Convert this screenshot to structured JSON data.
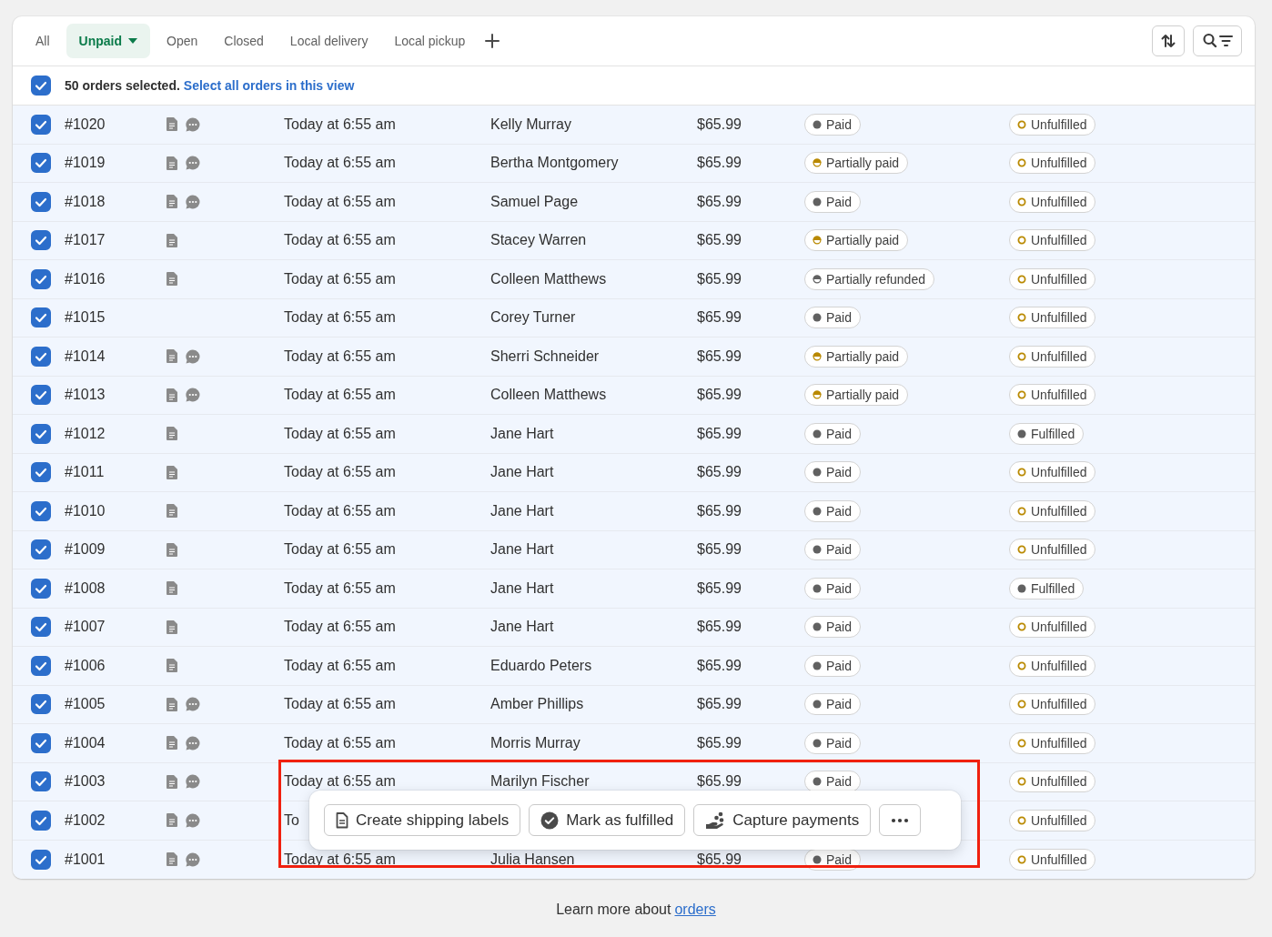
{
  "tabs": [
    {
      "label": "All",
      "selected": false,
      "dropdown": false
    },
    {
      "label": "Unpaid",
      "selected": true,
      "dropdown": true
    },
    {
      "label": "Open",
      "selected": false,
      "dropdown": false
    },
    {
      "label": "Closed",
      "selected": false,
      "dropdown": false
    },
    {
      "label": "Local delivery",
      "selected": false,
      "dropdown": false
    },
    {
      "label": "Local pickup",
      "selected": false,
      "dropdown": false
    }
  ],
  "bulk": {
    "checked": true,
    "text": "50 orders selected.",
    "link": "Select all orders in this view"
  },
  "rows": [
    {
      "checked": true,
      "order": "#1020",
      "note": true,
      "comment": true,
      "date": "Today at 6:55 am",
      "customer": "Kelly Murray",
      "total": "$65.99",
      "payment": {
        "label": "Paid",
        "kind": "paid"
      },
      "fulfillment": {
        "label": "Unfulfilled",
        "kind": "unfulfilled"
      }
    },
    {
      "checked": true,
      "order": "#1019",
      "note": true,
      "comment": true,
      "date": "Today at 6:55 am",
      "customer": "Bertha Montgomery",
      "total": "$65.99",
      "payment": {
        "label": "Partially paid",
        "kind": "partially_paid"
      },
      "fulfillment": {
        "label": "Unfulfilled",
        "kind": "unfulfilled"
      }
    },
    {
      "checked": true,
      "order": "#1018",
      "note": true,
      "comment": true,
      "date": "Today at 6:55 am",
      "customer": "Samuel Page",
      "total": "$65.99",
      "payment": {
        "label": "Paid",
        "kind": "paid"
      },
      "fulfillment": {
        "label": "Unfulfilled",
        "kind": "unfulfilled"
      }
    },
    {
      "checked": true,
      "order": "#1017",
      "note": true,
      "comment": false,
      "date": "Today at 6:55 am",
      "customer": "Stacey Warren",
      "total": "$65.99",
      "payment": {
        "label": "Partially paid",
        "kind": "partially_paid"
      },
      "fulfillment": {
        "label": "Unfulfilled",
        "kind": "unfulfilled"
      }
    },
    {
      "checked": true,
      "order": "#1016",
      "note": true,
      "comment": false,
      "date": "Today at 6:55 am",
      "customer": "Colleen Matthews",
      "total": "$65.99",
      "payment": {
        "label": "Partially refunded",
        "kind": "partially_refunded"
      },
      "fulfillment": {
        "label": "Unfulfilled",
        "kind": "unfulfilled"
      }
    },
    {
      "checked": true,
      "order": "#1015",
      "note": false,
      "comment": false,
      "date": "Today at 6:55 am",
      "customer": "Corey Turner",
      "total": "$65.99",
      "payment": {
        "label": "Paid",
        "kind": "paid"
      },
      "fulfillment": {
        "label": "Unfulfilled",
        "kind": "unfulfilled"
      }
    },
    {
      "checked": true,
      "order": "#1014",
      "note": true,
      "comment": true,
      "date": "Today at 6:55 am",
      "customer": "Sherri Schneider",
      "total": "$65.99",
      "payment": {
        "label": "Partially paid",
        "kind": "partially_paid"
      },
      "fulfillment": {
        "label": "Unfulfilled",
        "kind": "unfulfilled"
      }
    },
    {
      "checked": true,
      "order": "#1013",
      "note": true,
      "comment": true,
      "date": "Today at 6:55 am",
      "customer": "Colleen Matthews",
      "total": "$65.99",
      "payment": {
        "label": "Partially paid",
        "kind": "partially_paid"
      },
      "fulfillment": {
        "label": "Unfulfilled",
        "kind": "unfulfilled"
      }
    },
    {
      "checked": true,
      "order": "#1012",
      "note": true,
      "comment": false,
      "date": "Today at 6:55 am",
      "customer": "Jane Hart",
      "total": "$65.99",
      "payment": {
        "label": "Paid",
        "kind": "paid"
      },
      "fulfillment": {
        "label": "Fulfilled",
        "kind": "fulfilled"
      }
    },
    {
      "checked": true,
      "order": "#1011",
      "note": true,
      "comment": false,
      "date": "Today at 6:55 am",
      "customer": "Jane Hart",
      "total": "$65.99",
      "payment": {
        "label": "Paid",
        "kind": "paid"
      },
      "fulfillment": {
        "label": "Unfulfilled",
        "kind": "unfulfilled"
      }
    },
    {
      "checked": true,
      "order": "#1010",
      "note": true,
      "comment": false,
      "date": "Today at 6:55 am",
      "customer": "Jane Hart",
      "total": "$65.99",
      "payment": {
        "label": "Paid",
        "kind": "paid"
      },
      "fulfillment": {
        "label": "Unfulfilled",
        "kind": "unfulfilled"
      }
    },
    {
      "checked": true,
      "order": "#1009",
      "note": true,
      "comment": false,
      "date": "Today at 6:55 am",
      "customer": "Jane Hart",
      "total": "$65.99",
      "payment": {
        "label": "Paid",
        "kind": "paid"
      },
      "fulfillment": {
        "label": "Unfulfilled",
        "kind": "unfulfilled"
      }
    },
    {
      "checked": true,
      "order": "#1008",
      "note": true,
      "comment": false,
      "date": "Today at 6:55 am",
      "customer": "Jane Hart",
      "total": "$65.99",
      "payment": {
        "label": "Paid",
        "kind": "paid"
      },
      "fulfillment": {
        "label": "Fulfilled",
        "kind": "fulfilled"
      }
    },
    {
      "checked": true,
      "order": "#1007",
      "note": true,
      "comment": false,
      "date": "Today at 6:55 am",
      "customer": "Jane Hart",
      "total": "$65.99",
      "payment": {
        "label": "Paid",
        "kind": "paid"
      },
      "fulfillment": {
        "label": "Unfulfilled",
        "kind": "unfulfilled"
      }
    },
    {
      "checked": true,
      "order": "#1006",
      "note": true,
      "comment": false,
      "date": "Today at 6:55 am",
      "customer": "Eduardo Peters",
      "total": "$65.99",
      "payment": {
        "label": "Paid",
        "kind": "paid"
      },
      "fulfillment": {
        "label": "Unfulfilled",
        "kind": "unfulfilled"
      }
    },
    {
      "checked": true,
      "order": "#1005",
      "note": true,
      "comment": true,
      "date": "Today at 6:55 am",
      "customer": "Amber Phillips",
      "total": "$65.99",
      "payment": {
        "label": "Paid",
        "kind": "paid"
      },
      "fulfillment": {
        "label": "Unfulfilled",
        "kind": "unfulfilled"
      }
    },
    {
      "checked": true,
      "order": "#1004",
      "note": true,
      "comment": true,
      "date": "Today at 6:55 am",
      "customer": "Morris Murray",
      "total": "$65.99",
      "payment": {
        "label": "Paid",
        "kind": "paid"
      },
      "fulfillment": {
        "label": "Unfulfilled",
        "kind": "unfulfilled"
      }
    },
    {
      "checked": true,
      "order": "#1003",
      "note": true,
      "comment": true,
      "date": "Today at 6:55 am",
      "customer": "Marilyn Fischer",
      "total": "$65.99",
      "payment": {
        "label": "Paid",
        "kind": "paid"
      },
      "fulfillment": {
        "label": "Unfulfilled",
        "kind": "unfulfilled"
      }
    },
    {
      "checked": true,
      "order": "#1002",
      "note": true,
      "comment": true,
      "date": "To",
      "fulfillment": {
        "label": "Unfulfilled",
        "kind": "unfulfilled"
      }
    },
    {
      "checked": true,
      "order": "#1001",
      "note": true,
      "comment": true,
      "date": "Today at 6:55 am",
      "customer": "Julia Hansen",
      "total": "$65.99",
      "payment": {
        "label": "Paid",
        "kind": "paid"
      },
      "fulfillment": {
        "label": "Unfulfilled",
        "kind": "unfulfilled"
      }
    }
  ],
  "actions": [
    {
      "label": "Create shipping labels",
      "kind": "document"
    },
    {
      "label": "Mark as fulfilled",
      "kind": "check"
    },
    {
      "label": "Capture payments",
      "kind": "capture"
    },
    {
      "kind": "more"
    }
  ],
  "footer": {
    "text": "Learn more about",
    "link": "orders"
  }
}
